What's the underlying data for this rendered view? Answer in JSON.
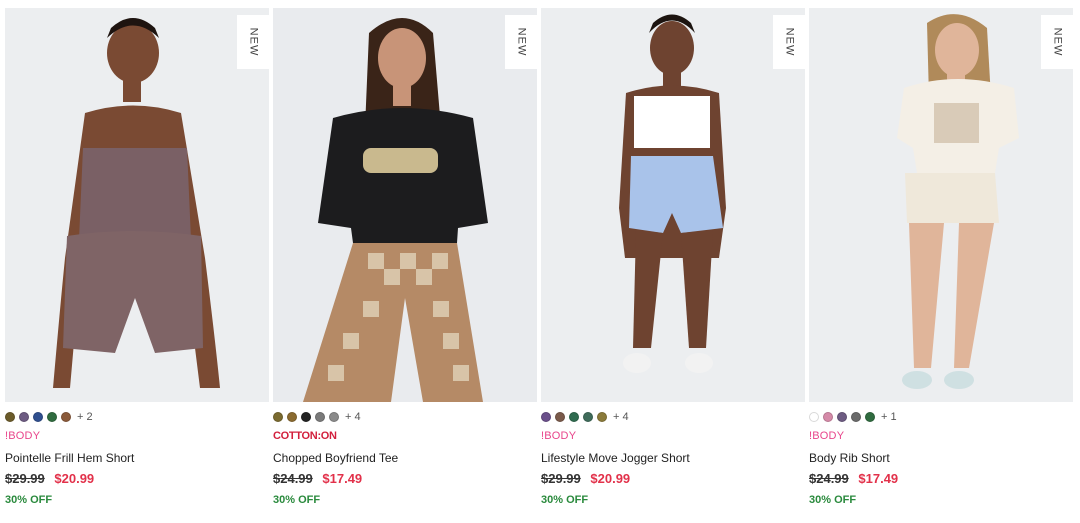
{
  "products": [
    {
      "badge": "NEW",
      "swatches": [
        "#6b5b2a",
        "#6d5b82",
        "#2f4f8f",
        "#2f6b3f",
        "#8a5a3a"
      ],
      "more": "+ 2",
      "brand": "!BODY",
      "name": "Pointelle Frill Hem Short",
      "was": "$29.99",
      "now": "$20.99",
      "off": "30% OFF"
    },
    {
      "badge": "NEW",
      "swatches": [
        "#7a6a2f",
        "#8a6a2f",
        "#222222",
        "#7a7a7a",
        "#8a8a8a"
      ],
      "more": "+ 4",
      "brand": "COTTON:ON",
      "name": "Chopped Boyfriend Tee",
      "was": "$24.99",
      "now": "$17.49",
      "off": "30% OFF"
    },
    {
      "badge": "NEW",
      "swatches": [
        "#6a4f8a",
        "#7a5a4a",
        "#2f6b4f",
        "#3f6b5a",
        "#8a7a3a"
      ],
      "more": "+ 4",
      "brand": "!BODY",
      "name": "Lifestyle Move Jogger Short",
      "was": "$29.99",
      "now": "$20.99",
      "off": "30% OFF"
    },
    {
      "badge": "NEW",
      "swatches": [
        "#ffffff",
        "#d58aa8",
        "#6d5b82",
        "#6a6a6a",
        "#2f6b3f"
      ],
      "more": "+ 1",
      "brand": "!BODY",
      "name": "Body Rib Short",
      "was": "$24.99",
      "now": "$17.49",
      "off": "30% OFF"
    }
  ]
}
